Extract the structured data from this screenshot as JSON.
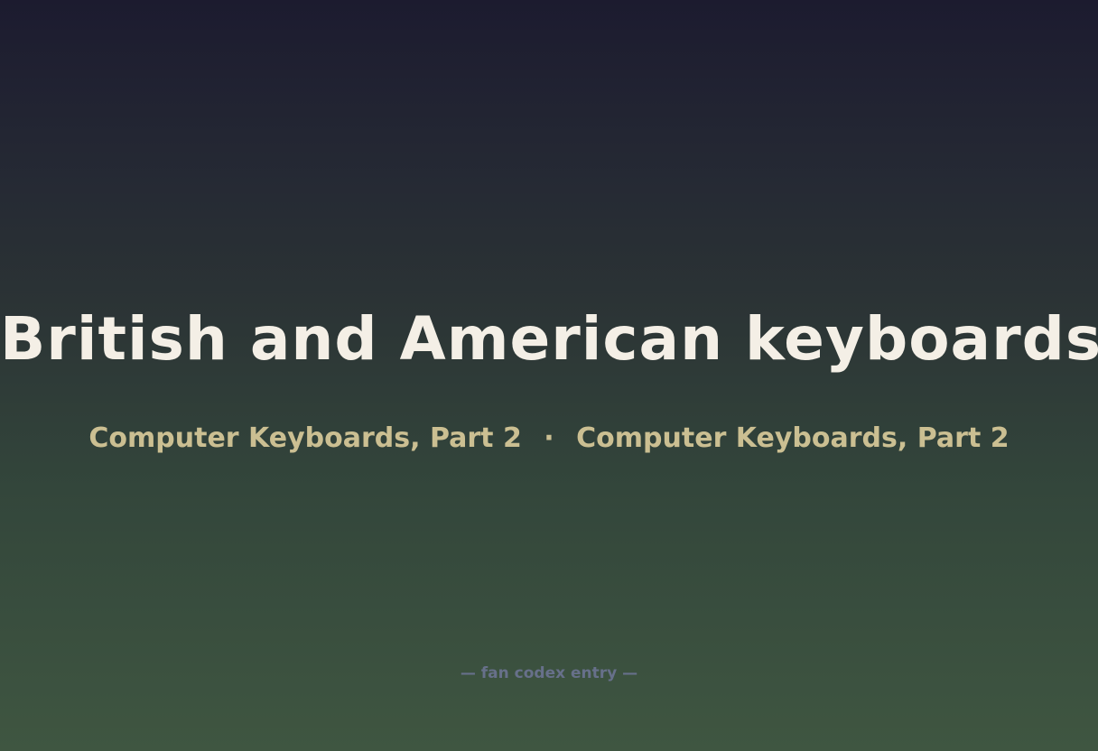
{
  "title": "British and American keyboards",
  "subtitle": {
    "left": "Computer Keyboards, Part 2",
    "separator": "·",
    "right": "Computer Keyboards, Part 2"
  },
  "footer": "— fan codex entry —",
  "colors": {
    "title": "#f4efe6",
    "subtitle": "#cbbf92",
    "footer": "#67708a",
    "background_top": "#1c1b2f",
    "background_bottom": "#3f5641"
  }
}
